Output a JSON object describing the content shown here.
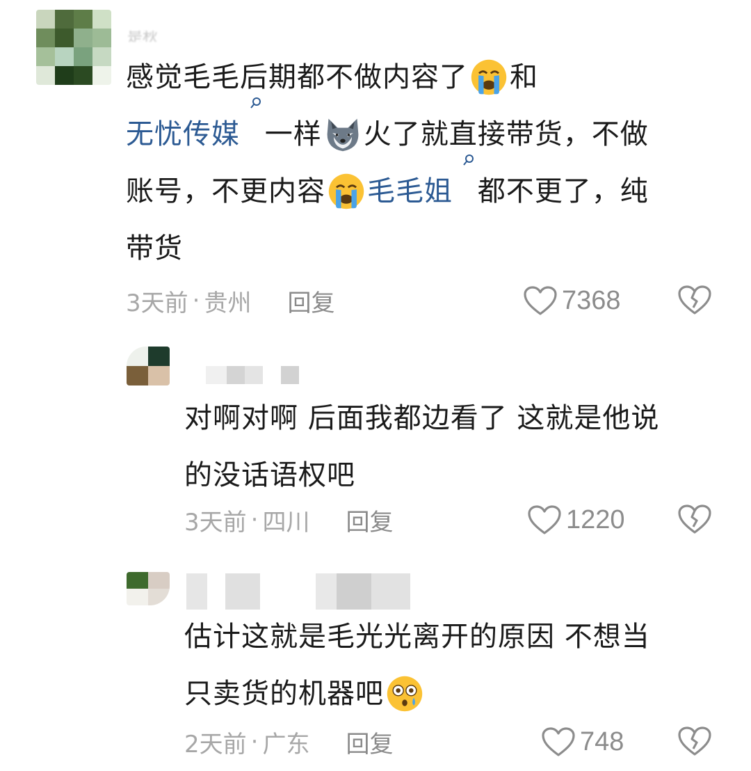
{
  "comments": [
    {
      "username": "是秋",
      "text_lines": [
        [
          "感觉毛毛后期都不做内容了",
          {
            "emoji": "loudly-crying-face"
          },
          "和"
        ],
        [
          {
            "mention": "无忧传媒"
          },
          "一样",
          {
            "emoji": "wolf-face"
          },
          "火了就直接带货，不做"
        ],
        [
          "账号，不更内容",
          {
            "emoji": "loudly-crying-face"
          },
          {
            "mention": "毛毛姐"
          },
          "都不更了，纯"
        ],
        [
          "带货"
        ]
      ],
      "time": "3天前",
      "location": "贵州",
      "reply_label": "回复",
      "likes": "7368"
    },
    {
      "username": "",
      "text_lines": [
        [
          "对啊对啊 后面我都边看了 这就是他说"
        ],
        [
          "的没话语权吧"
        ]
      ],
      "time": "3天前",
      "location": "四川",
      "reply_label": "回复",
      "likes": "1220"
    },
    {
      "username": "",
      "text_lines": [
        [
          "估计这就是毛光光离开的原因 不想当"
        ],
        [
          "只卖货的机器吧",
          {
            "emoji": "flushed-face"
          }
        ]
      ],
      "time": "2天前",
      "location": "广东",
      "reply_label": "回复",
      "likes": "748"
    }
  ],
  "meta_separator": "·",
  "icons": {
    "like": "heart-outline-icon",
    "dislike": "broken-heart-icon",
    "mention_search": "search-icon"
  },
  "colors": {
    "mention": "#2c5a93",
    "meta": "#a7a7a7",
    "text": "#1a1a1a"
  }
}
